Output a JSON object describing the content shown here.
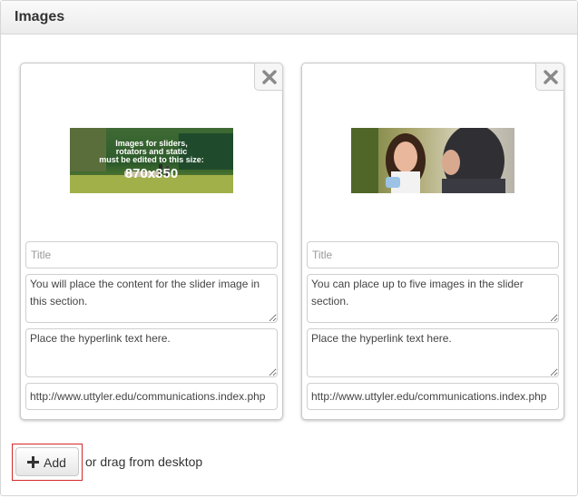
{
  "panel": {
    "title": "Images"
  },
  "cards": [
    {
      "image": {
        "lines": [
          "Images for sliders,",
          "rotators and static",
          "must be edited to this size:"
        ],
        "size": "870x350"
      },
      "title_placeholder": "Title",
      "description": "You will place the content for the slider image in this section.",
      "link_text": "Place the hyperlink text here.",
      "url": "http://www.uttyler.edu/communications.index.php"
    },
    {
      "image": {
        "alt_icon": "photo-two-women"
      },
      "title_placeholder": "Title",
      "description": "You can place up to five images in the slider section.",
      "link_text": "Place the hyperlink text here.",
      "url": "http://www.uttyler.edu/communications.index.php"
    }
  ],
  "actions": {
    "add_label": "Add",
    "drag_text": "or drag from desktop"
  },
  "icons": {
    "close": "close-icon",
    "add": "plus-icon"
  },
  "colors": {
    "highlight": "#d62728",
    "close_icon": "#8a8a8a"
  }
}
